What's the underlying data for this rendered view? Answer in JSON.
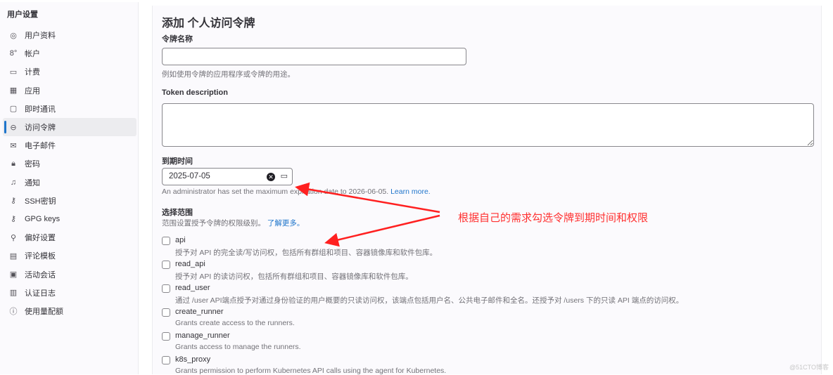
{
  "sidebar": {
    "title": "用户设置",
    "items": [
      {
        "icon": "user-circle-icon",
        "glyph": "◎",
        "label": "用户资料"
      },
      {
        "icon": "account-icon",
        "glyph": "8°",
        "label": "帐户"
      },
      {
        "icon": "credit-card-icon",
        "glyph": "▭",
        "label": "计费"
      },
      {
        "icon": "applications-icon",
        "glyph": "▦",
        "label": "应用"
      },
      {
        "icon": "chat-icon",
        "glyph": "▢",
        "label": "即时通讯"
      },
      {
        "icon": "token-icon",
        "glyph": "⊖",
        "label": "访问令牌",
        "active": true
      },
      {
        "icon": "mail-icon",
        "glyph": "✉",
        "label": "电子邮件"
      },
      {
        "icon": "lock-icon",
        "glyph": "🔒︎",
        "label": "密码"
      },
      {
        "icon": "bell-icon",
        "glyph": "♫",
        "label": "通知"
      },
      {
        "icon": "key-icon",
        "glyph": "⚷",
        "label": "SSH密钥"
      },
      {
        "icon": "key-icon",
        "glyph": "⚷",
        "label": "GPG keys"
      },
      {
        "icon": "preferences-icon",
        "glyph": "⚲",
        "label": "偏好设置"
      },
      {
        "icon": "comment-template-icon",
        "glyph": "▤",
        "label": "评论模板"
      },
      {
        "icon": "monitor-icon",
        "glyph": "▣",
        "label": "活动会话"
      },
      {
        "icon": "log-icon",
        "glyph": "▥",
        "label": "认证日志"
      },
      {
        "icon": "usage-icon",
        "glyph": "ⓘ",
        "label": "使用量配额"
      }
    ]
  },
  "form": {
    "title": "添加 个人访问令牌",
    "name_label": "令牌名称",
    "name_value": "",
    "name_help": "例如使用令牌的应用程序或令牌的用途。",
    "desc_label": "Token description",
    "desc_value": "",
    "expiry_label": "到期时间",
    "expiry_value": "2025-07-05",
    "expiry_help": "An administrator has set the maximum expiration date to 2026-06-05.",
    "expiry_link": "Learn more.",
    "scope_label": "选择范围",
    "scope_help": "范围设置授予令牌的权限级别。",
    "scope_link": "了解更多。",
    "scopes": [
      {
        "name": "api",
        "desc": "授予对 API 的完全读/写访问权，包括所有群组和项目、容器镜像库和软件包库。",
        "checked": false
      },
      {
        "name": "read_api",
        "desc": "授予对 API 的读访问权，包括所有群组和项目、容器镜像库和软件包库。",
        "checked": false
      },
      {
        "name": "read_user",
        "desc": "通过 /user API端点授予对通过身份验证的用户概要的只读访问权，该端点包括用户名、公共电子邮件和全名。还授予对 /users 下的只读 API 端点的访问权。",
        "checked": false
      },
      {
        "name": "create_runner",
        "desc": "Grants create access to the runners.",
        "checked": false
      },
      {
        "name": "manage_runner",
        "desc": "Grants access to manage the runners.",
        "checked": false
      },
      {
        "name": "k8s_proxy",
        "desc": "Grants permission to perform Kubernetes API calls using the agent for Kubernetes.",
        "checked": false
      }
    ]
  },
  "annotation": "根据自己的需求勾选令牌到期时间和权限",
  "watermark": "@51CTO博客"
}
